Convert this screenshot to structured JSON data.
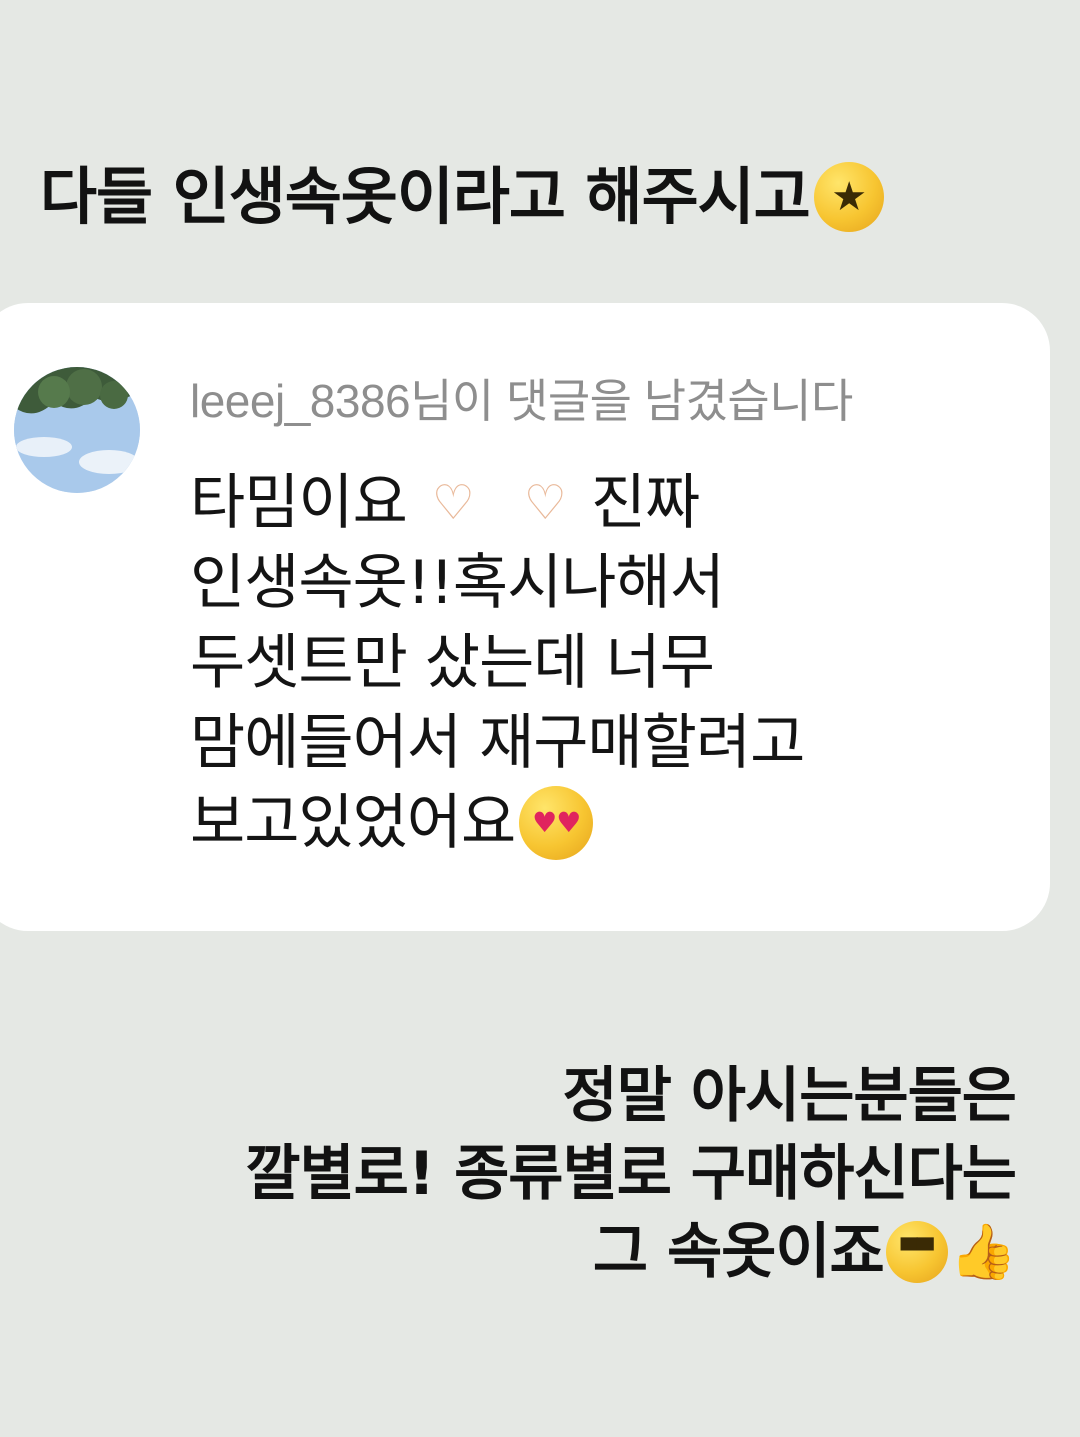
{
  "headline": {
    "text": "다들 인생속옷이라고 해주시고",
    "emoji": "star-struck-emoji"
  },
  "comment": {
    "commenter_text": "leeej_8386님이 댓글을 남겼습니다",
    "lines": [
      "타밈이요",
      "진짜",
      "인생속옷!!혹시나해서",
      "두셋트만 샀는데 너무",
      "맘에들어서 재구매할려고",
      "보고있었어요"
    ],
    "emojis": [
      "heart-hands-emoji",
      "heart-eyes-emoji"
    ]
  },
  "reply": {
    "lines": [
      "정말 아시는분들은",
      "깔별로! 종류별로 구매하신다는",
      "그 속옷이죠"
    ],
    "emojis": [
      "sunglasses-emoji",
      "thumbs-up-emoji"
    ]
  },
  "colors": {
    "background": "#e5e8e4",
    "card": "#ffffff",
    "commenter_text": "#8e8e8e",
    "text": "#121212"
  }
}
